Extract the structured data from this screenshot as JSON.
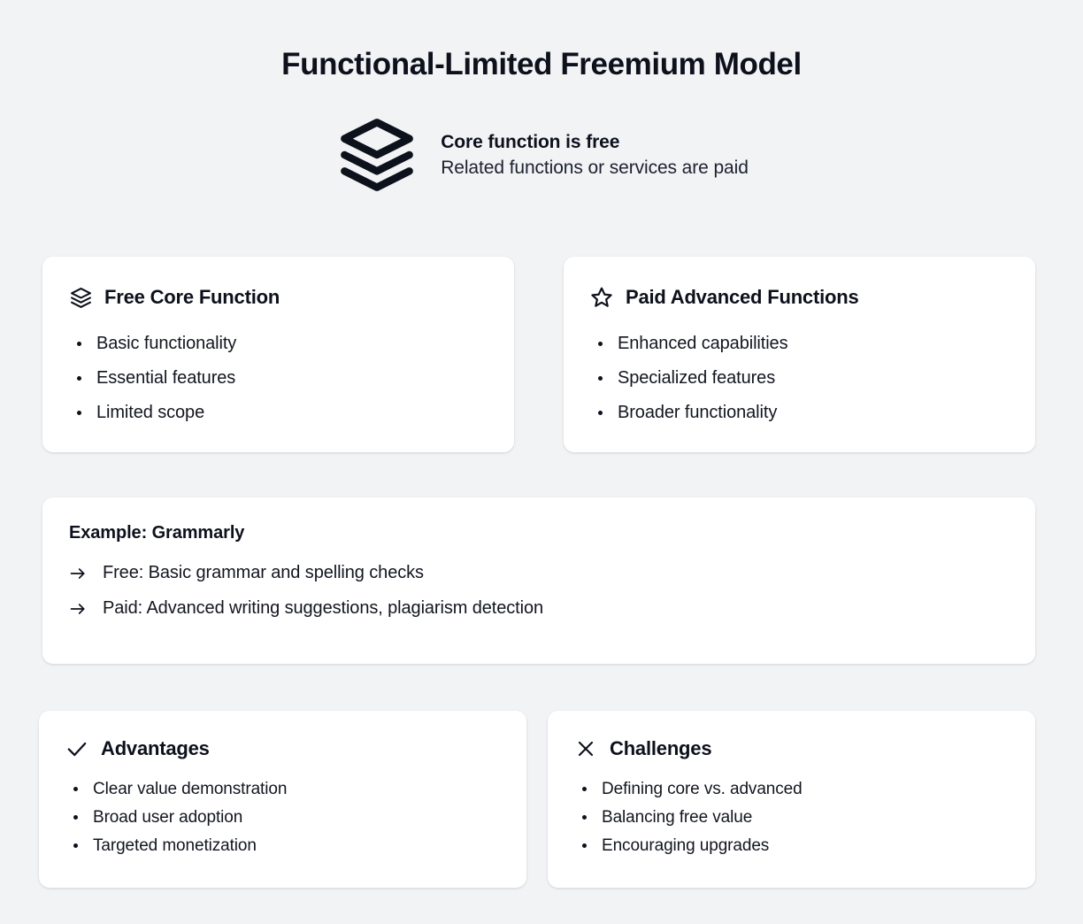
{
  "header": {
    "title": "Functional-Limited Freemium Model",
    "icon": "layers-icon",
    "primary": "Core function is free",
    "secondary": "Related functions or services are paid"
  },
  "cards": {
    "free": {
      "icon": "layers-icon",
      "title": "Free Core Function",
      "items": [
        "Basic functionality",
        "Essential features",
        "Limited scope"
      ]
    },
    "paid": {
      "icon": "star-icon",
      "title": "Paid Advanced Functions",
      "items": [
        "Enhanced capabilities",
        "Specialized features",
        "Broader functionality"
      ]
    },
    "example": {
      "title": "Example: Grammarly",
      "marker": "arrow-right-icon",
      "items": [
        "Free: Basic grammar and spelling checks",
        "Paid: Advanced writing suggestions, plagiarism detection"
      ]
    },
    "advantages": {
      "icon": "check-icon",
      "title": "Advantages",
      "items": [
        "Clear value demonstration",
        "Broad user adoption",
        "Targeted monetization"
      ]
    },
    "challenges": {
      "icon": "close-icon",
      "title": "Challenges",
      "items": [
        "Defining core vs. advanced",
        "Balancing free value",
        "Encouraging upgrades"
      ]
    }
  },
  "colors": {
    "background": "#f1f3f5",
    "card": "#ffffff",
    "text": "#0d111c"
  }
}
